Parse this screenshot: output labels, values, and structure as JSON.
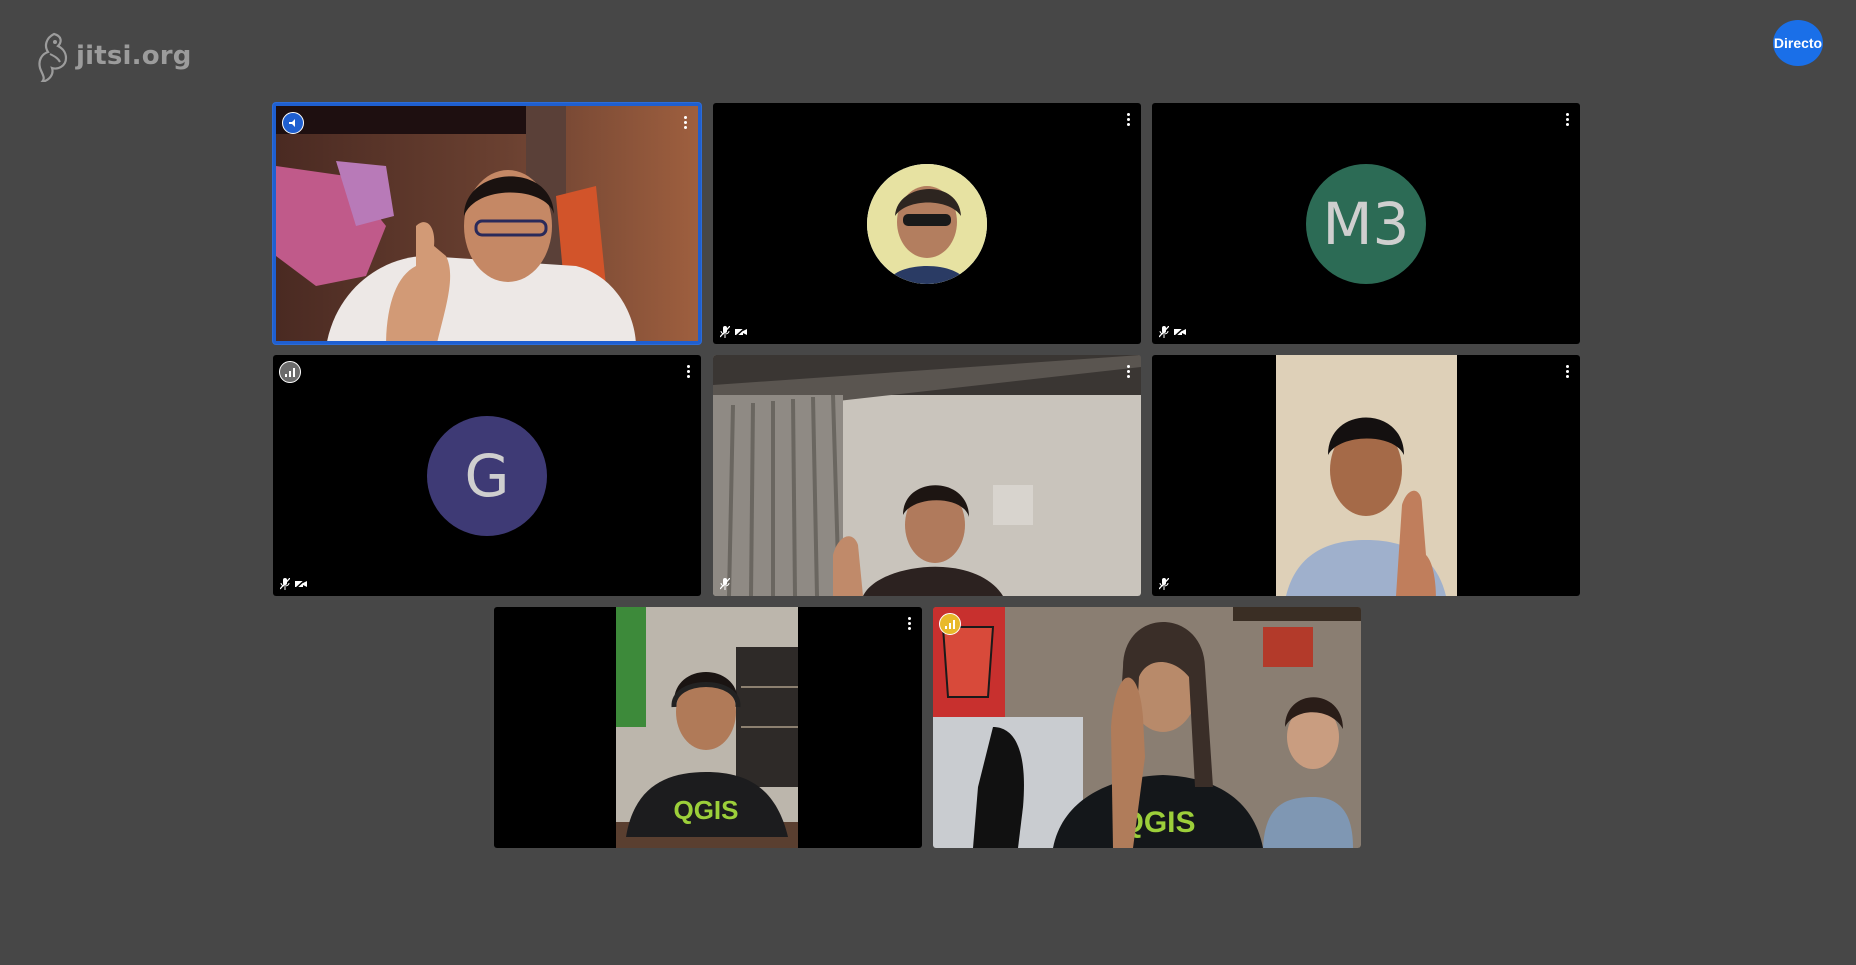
{
  "app": {
    "logo_text": "jitsi.org",
    "live_badge": "Directo"
  },
  "colors": {
    "background": "#474747",
    "active_border": "#1f5fd0",
    "live_badge": "#1a6fe8",
    "avatar_m3": "#2c6b55",
    "avatar_g": "#3e3a75",
    "connection_good": "#7a7a7a",
    "connection_warn": "#e8b92a"
  },
  "tiles": [
    {
      "id": "tile-1",
      "kind": "video",
      "active": true,
      "indicator": "dominant-speaker-icon",
      "muted_audio": false,
      "muted_video": false
    },
    {
      "id": "tile-2",
      "kind": "avatar-photo",
      "active": false,
      "indicator": null,
      "muted_audio": true,
      "muted_video": true
    },
    {
      "id": "tile-3",
      "kind": "avatar-initials",
      "initials": "M3",
      "active": false,
      "indicator": null,
      "muted_audio": true,
      "muted_video": true
    },
    {
      "id": "tile-4",
      "kind": "avatar-initials",
      "initials": "G",
      "active": false,
      "indicator": "connection-status-icon",
      "muted_audio": true,
      "muted_video": true
    },
    {
      "id": "tile-5",
      "kind": "video",
      "active": false,
      "indicator": null,
      "muted_audio": true,
      "muted_video": false
    },
    {
      "id": "tile-6",
      "kind": "video",
      "active": false,
      "indicator": null,
      "muted_audio": true,
      "muted_video": false
    },
    {
      "id": "tile-7",
      "kind": "video",
      "active": false,
      "indicator": null,
      "muted_audio": false,
      "muted_video": false
    },
    {
      "id": "tile-8",
      "kind": "video",
      "active": false,
      "indicator": "connection-warning-icon",
      "muted_audio": false,
      "muted_video": false
    }
  ]
}
